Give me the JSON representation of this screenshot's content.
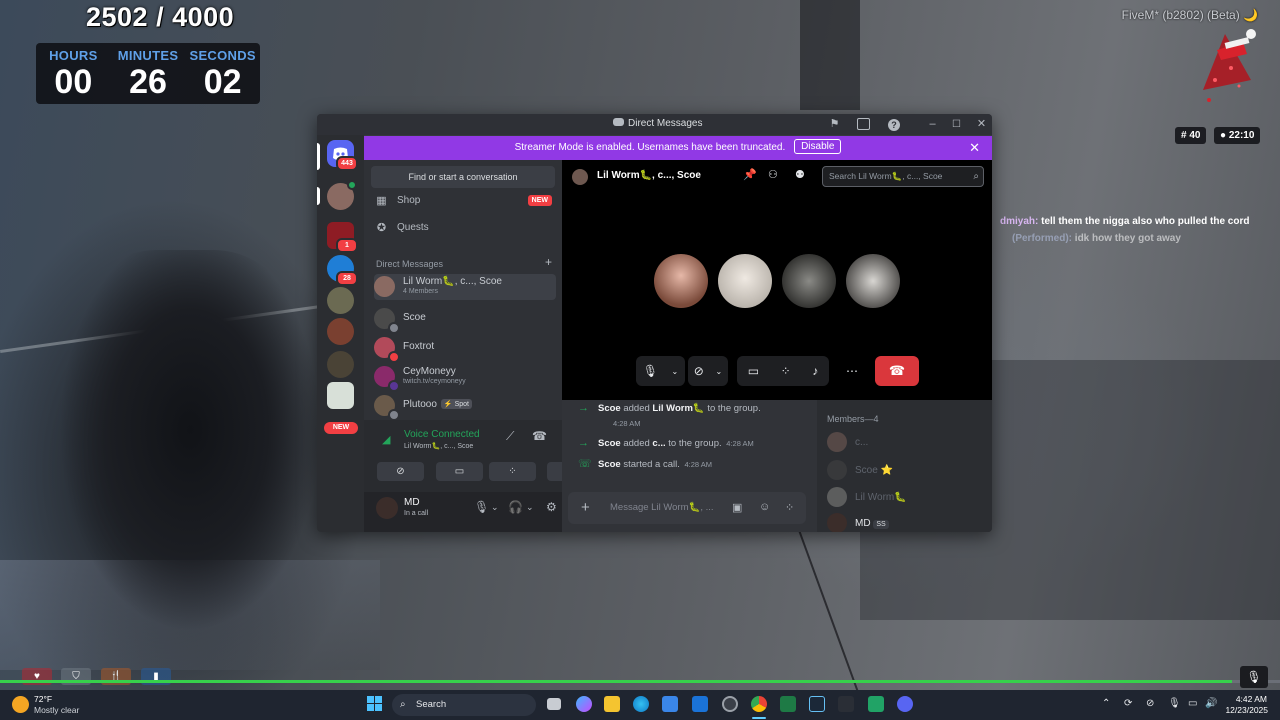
{
  "hud": {
    "goal_counter": "2502 / 4000",
    "timer": [
      {
        "label": "HOURS",
        "value": "00"
      },
      {
        "label": "MINUTES",
        "value": "26"
      },
      {
        "label": "SECONDS",
        "value": "02"
      }
    ],
    "fivem_label": "FiveM* (b2802) (Beta) 🌙",
    "badge_players": "# 40",
    "badge_time": "● 22:10"
  },
  "game_chat": [
    {
      "name": "dmiyah:",
      "text": "tell them the nigga also who pulled the cord"
    },
    {
      "name": "(Performed):",
      "text": "idk how they got away"
    }
  ],
  "discord": {
    "window_title": "Direct Messages",
    "banner": {
      "text": "Streamer Mode is enabled. Usernames have been truncated.",
      "button": "Disable"
    },
    "servers": [
      {
        "name": "home",
        "badge": "443",
        "color": "#5865f2"
      },
      {
        "name": "group-call",
        "badge": "",
        "color": "#8a6a62"
      },
      {
        "name": "server-3",
        "badge": "1",
        "color": "#8e1c24"
      },
      {
        "name": "server-4",
        "badge": "28",
        "color": "#1f7ed6"
      },
      {
        "name": "server-5",
        "badge": "",
        "color": "#6b6a52"
      },
      {
        "name": "server-6",
        "badge": "",
        "color": "#7a4030"
      },
      {
        "name": "server-7",
        "badge": "",
        "color": "#4a4336"
      },
      {
        "name": "server-8",
        "badge": "",
        "color": "#d8e0d8"
      }
    ],
    "rail_new": "NEW",
    "find_conversation": "Find or start a conversation",
    "nav": [
      {
        "label": "Shop",
        "icon": "shop-icon"
      },
      {
        "label": "Quests",
        "icon": "quests-icon"
      }
    ],
    "shop_new": "NEW",
    "dm_header": "Direct Messages",
    "dms": [
      {
        "name": "Lil Worm🐛, c..., Scoe",
        "sub": "4 Members",
        "color": "#8a6a62"
      },
      {
        "name": "Scoe",
        "sub": "",
        "color": "#4a4a4a"
      },
      {
        "name": "Foxtrot",
        "sub": "",
        "color": "#b24a5a"
      },
      {
        "name": "CeyMoneyy",
        "sub": "twitch.tv/ceymoneyy",
        "color": "#8a2a6a"
      },
      {
        "name": "Plutooo",
        "sub": "",
        "color": "#6a5a4a",
        "tag": "⚡ Spot"
      }
    ],
    "voice": {
      "status": "Voice Connected",
      "channel": "Lil Worm🐛, c..., Scoe"
    },
    "user": {
      "name": "MD",
      "status": "In a call"
    },
    "call": {
      "title": "Lil Worm🐛, c..., Scoe",
      "search_placeholder": "Search Lil Worm🐛, c..., Scoe",
      "participants": [
        {
          "name": "participant-1",
          "color": "#c48a7a"
        },
        {
          "name": "participant-2",
          "color": "#d6d2cc"
        },
        {
          "name": "participant-3",
          "color": "#4a4a48"
        },
        {
          "name": "participant-4",
          "color": "#9a9894"
        }
      ]
    },
    "messages": [
      {
        "actor": "Scoe",
        "verb": "added",
        "target": "Lil Worm🐛",
        "rest": "to the group.",
        "time": "4:28 AM"
      },
      {
        "actor": "Scoe",
        "verb": "added",
        "target": "c...",
        "rest": "to the group.",
        "time": "4:28 AM"
      },
      {
        "actor": "Scoe",
        "verb": "started a call.",
        "target": "",
        "rest": "",
        "time": "4:28 AM"
      }
    ],
    "message_placeholder": "Message Lil Worm🐛, ...",
    "members_header": "Members—4",
    "members": [
      {
        "name": "c...",
        "color": "#8a6a62"
      },
      {
        "name": "Scoe ⭐",
        "color": "#4a4a4a"
      },
      {
        "name": "Lil Worm🐛",
        "color": "#9a9894"
      },
      {
        "name": "MD",
        "color": "#3b2d2a",
        "tag": "SS"
      }
    ]
  },
  "taskbar": {
    "weather_temp": "72°F",
    "weather_desc": "Mostly clear",
    "search": "Search",
    "time": "4:42 AM",
    "date": "12/23/2025"
  }
}
